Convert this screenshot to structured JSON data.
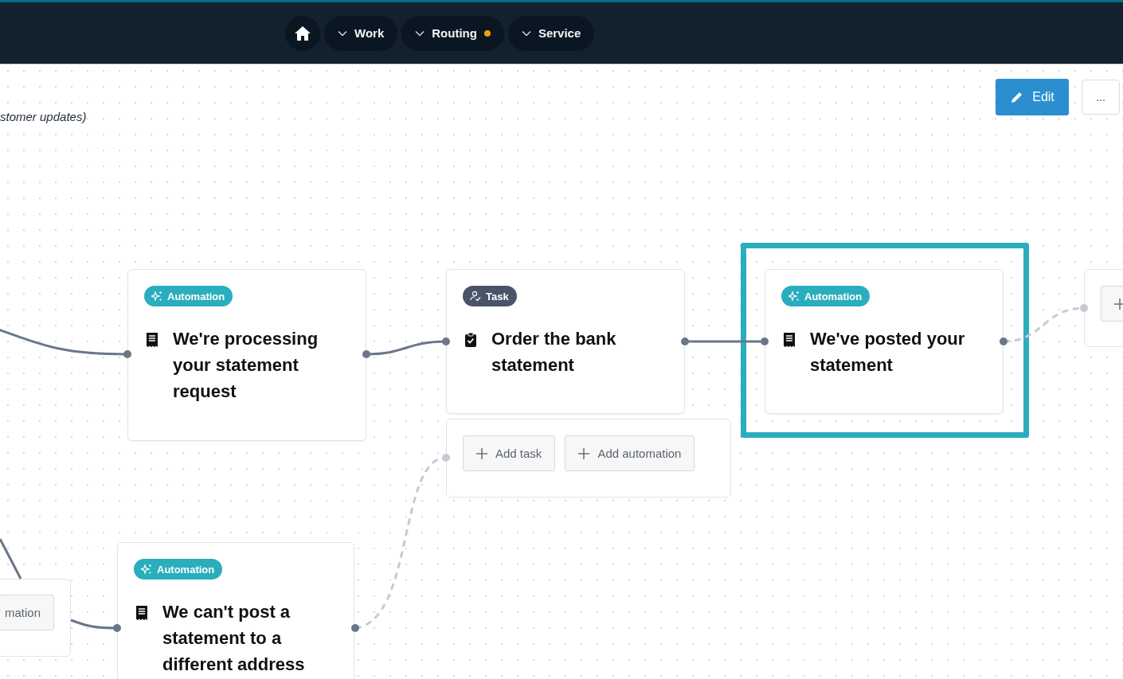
{
  "nav": {
    "items": [
      {
        "label": "Work",
        "indicator": false
      },
      {
        "label": "Routing",
        "indicator": true
      },
      {
        "label": "Service",
        "indicator": false
      }
    ]
  },
  "caption": "stomer updates)",
  "toolbar": {
    "edit_button": "Edit",
    "more_button": "..."
  },
  "nodes": [
    {
      "kind": "automation",
      "badge": "Automation",
      "title": "We're processing your statement request",
      "selected": false
    },
    {
      "kind": "task",
      "badge": "Task",
      "title": "Order the bank statement",
      "selected": false
    },
    {
      "kind": "automation",
      "badge": "Automation",
      "title": "We've posted your statement",
      "selected": true
    },
    {
      "kind": "automation",
      "badge": "Automation",
      "title": "We can't post a statement to a different address",
      "selected": false
    }
  ],
  "add_panel": {
    "buttons": [
      "Add task",
      "Add automation"
    ]
  },
  "partial_node_left": {
    "button": "mation"
  }
}
